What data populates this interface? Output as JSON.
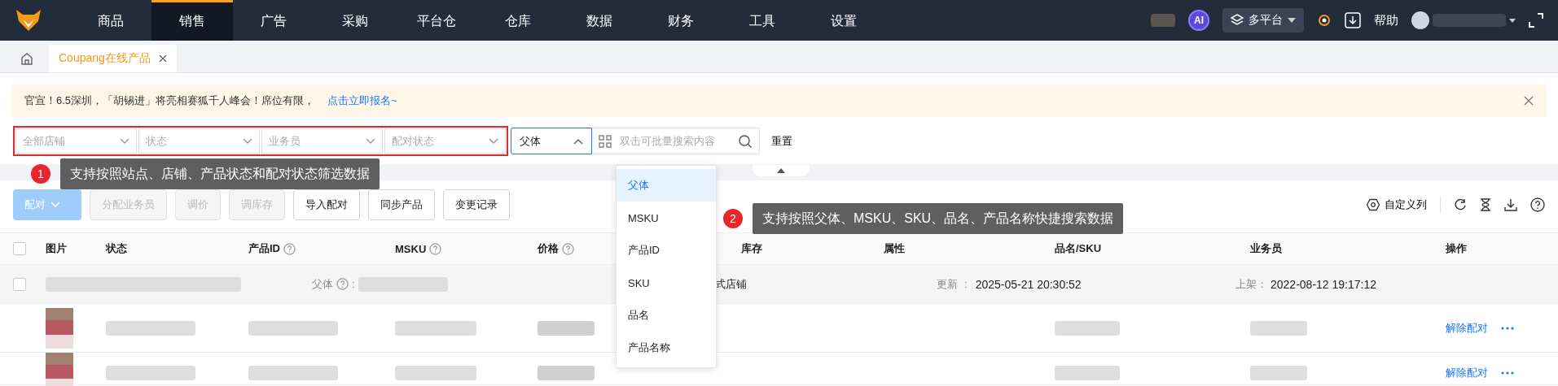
{
  "nav": {
    "items": [
      {
        "label": "商品",
        "selected": false
      },
      {
        "label": "销售",
        "selected": true
      },
      {
        "label": "广告",
        "selected": false
      },
      {
        "label": "采购",
        "selected": false
      },
      {
        "label": "平台仓",
        "selected": false
      },
      {
        "label": "仓库",
        "selected": false
      },
      {
        "label": "数据",
        "selected": false
      },
      {
        "label": "财务",
        "selected": false
      },
      {
        "label": "工具",
        "selected": false
      },
      {
        "label": "设置",
        "selected": false
      }
    ],
    "ai_badge": "AI",
    "platform": "多平台",
    "help": "帮助"
  },
  "tabs": [
    {
      "label": "Coupang在线产品",
      "selected": true
    }
  ],
  "banner": {
    "text": "官宣！6.5深圳，「胡锡进」将亮相赛狐千人峰会！席位有限，",
    "link": "点击立即报名~"
  },
  "filters": [
    {
      "placeholder": "全部店铺"
    },
    {
      "placeholder": "状态"
    },
    {
      "placeholder": "业务员"
    },
    {
      "placeholder": "配对状态"
    }
  ],
  "search": {
    "mode": "父体",
    "expanded": true,
    "placeholder": "双击可批量搜索内容",
    "reset": "重置",
    "options": [
      {
        "label": "父体",
        "selected": true
      },
      {
        "label": "MSKU",
        "selected": false
      },
      {
        "label": "产品ID",
        "selected": false
      },
      {
        "label": "SKU",
        "selected": false
      },
      {
        "label": "品名",
        "selected": false
      },
      {
        "label": "产品名称",
        "selected": false
      }
    ]
  },
  "tips": [
    {
      "number": "1",
      "text": "支持按照站点、店铺、产品状态和配对状态筛选数据"
    },
    {
      "number": "2",
      "text": "支持按照父体、MSKU、SKU、品名、产品名称快捷搜索数据"
    }
  ],
  "toolbar": {
    "buttons": [
      {
        "label": "配对",
        "kind": "dropdown",
        "disabled": true
      },
      {
        "label": "分配业务员",
        "kind": "plain",
        "disabled": true
      },
      {
        "label": "调价",
        "kind": "plain",
        "disabled": true
      },
      {
        "label": "调库存",
        "kind": "plain",
        "disabled": true
      },
      {
        "label": "导入配对",
        "kind": "plain",
        "disabled": false
      },
      {
        "label": "同步产品",
        "kind": "plain",
        "disabled": false
      },
      {
        "label": "变更记录",
        "kind": "plain",
        "disabled": false
      }
    ],
    "custom_columns": "自定义列"
  },
  "table": {
    "columns": [
      {
        "label": "图片",
        "help": false
      },
      {
        "label": "状态",
        "help": false
      },
      {
        "label": "产品ID",
        "help": true
      },
      {
        "label": "MSKU",
        "help": true
      },
      {
        "label": "价格",
        "help": true
      },
      {
        "label": "库存",
        "help": false
      },
      {
        "label": "属性",
        "help": false
      },
      {
        "label": "品名/SKU",
        "help": false
      },
      {
        "label": "业务员",
        "help": false
      },
      {
        "label": "操作",
        "help": false
      }
    ],
    "select_all_checked": false,
    "parent_row": {
      "checked": false,
      "parent_label": "父体",
      "separator": ":",
      "store": "式店铺",
      "updated_label": "更新",
      "updated": "2025-05-21 20:30:52",
      "listed_label": "上架：",
      "listed": "2022-08-12 19:17:12"
    },
    "rows": [
      {
        "action": "解除配对"
      },
      {
        "action": "解除配对"
      }
    ]
  }
}
